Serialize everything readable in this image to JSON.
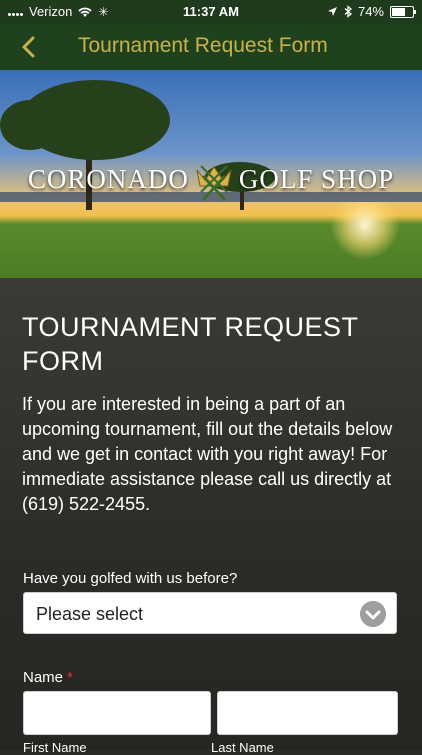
{
  "status_bar": {
    "carrier": "Verizon",
    "time": "11:37 AM",
    "battery": "74%",
    "battery_level": 0.74,
    "icons": [
      "signal-icon",
      "wifi-icon",
      "activity-icon",
      "location-icon",
      "bluetooth-icon",
      "battery-icon"
    ]
  },
  "navbar": {
    "title": "Tournament Request Form",
    "back_icon": "chevron-left-icon",
    "accent": "#c8b24a",
    "background": "#20411d"
  },
  "hero": {
    "logo_text_left": "CORONADO",
    "logo_text_right": "GOLF SHOP"
  },
  "form": {
    "heading": "TOURNAMENT REQUEST FORM",
    "intro": "If you are interested in being a part of an upcoming tournament, fill out the details below and we get in contact with you right away! For immediate assistance please call us directly at (619) 522-2455.",
    "golfed_question": "Have you golfed with us before?",
    "golfed_select_value": "Please select",
    "name_label": "Name",
    "required_mark": "*",
    "first_name_label": "First Name",
    "last_name_label": "Last Name",
    "first_name_value": "",
    "last_name_value": ""
  }
}
